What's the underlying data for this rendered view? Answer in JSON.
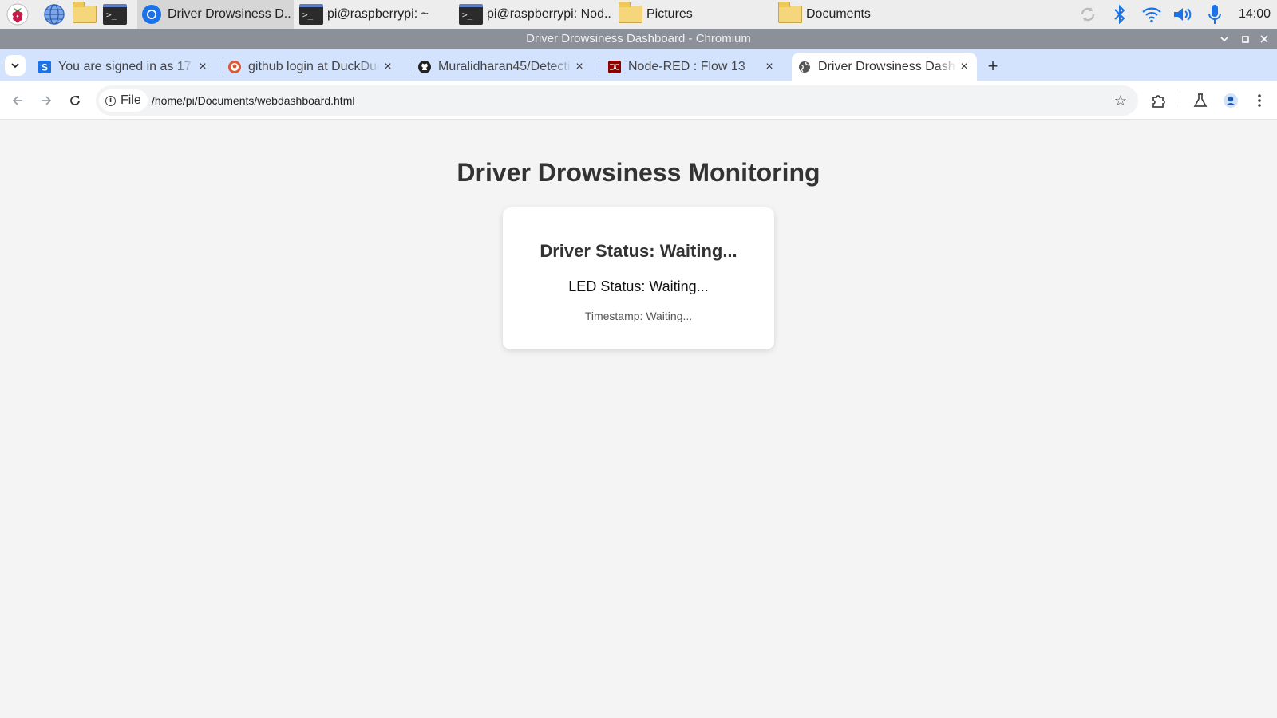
{
  "taskbar": {
    "tasks": [
      {
        "label": "Driver Drowsiness D..",
        "icon": "chromium-icon",
        "active": true
      },
      {
        "label": "pi@raspberrypi: ~",
        "icon": "terminal-icon",
        "active": false
      },
      {
        "label": "pi@raspberrypi: Nod..",
        "icon": "terminal-icon",
        "active": false
      },
      {
        "label": "Pictures",
        "icon": "folder-icon",
        "active": false
      },
      {
        "label": "Documents",
        "icon": "folder-icon",
        "active": false
      }
    ],
    "clock": "14:00"
  },
  "window": {
    "title": "Driver Drowsiness Dashboard - Chromium"
  },
  "tabs": [
    {
      "title": "You are signed in as 17",
      "favicon": "s-app-icon"
    },
    {
      "title": "github login at DuckDuc",
      "favicon": "duckduckgo-icon"
    },
    {
      "title": "Muralidharan45/Detecti",
      "favicon": "github-icon"
    },
    {
      "title": "Node-RED : Flow 13",
      "favicon": "node-red-icon"
    },
    {
      "title": "Driver Drowsiness Dash",
      "favicon": "globe-icon",
      "active": true
    }
  ],
  "toolbar": {
    "chip_label": "File",
    "url": "/home/pi/Documents/webdashboard.html"
  },
  "page": {
    "title": "Driver Drowsiness Monitoring",
    "driver_status": "Driver Status: Waiting...",
    "led_status": "LED Status: Waiting...",
    "timestamp": "Timestamp: Waiting..."
  },
  "colors": {
    "tabstrip": "#d3e3fd",
    "titlebar": "#8b9099",
    "page_bg": "#f4f4f4",
    "accent_blue": "#1a73e8"
  }
}
